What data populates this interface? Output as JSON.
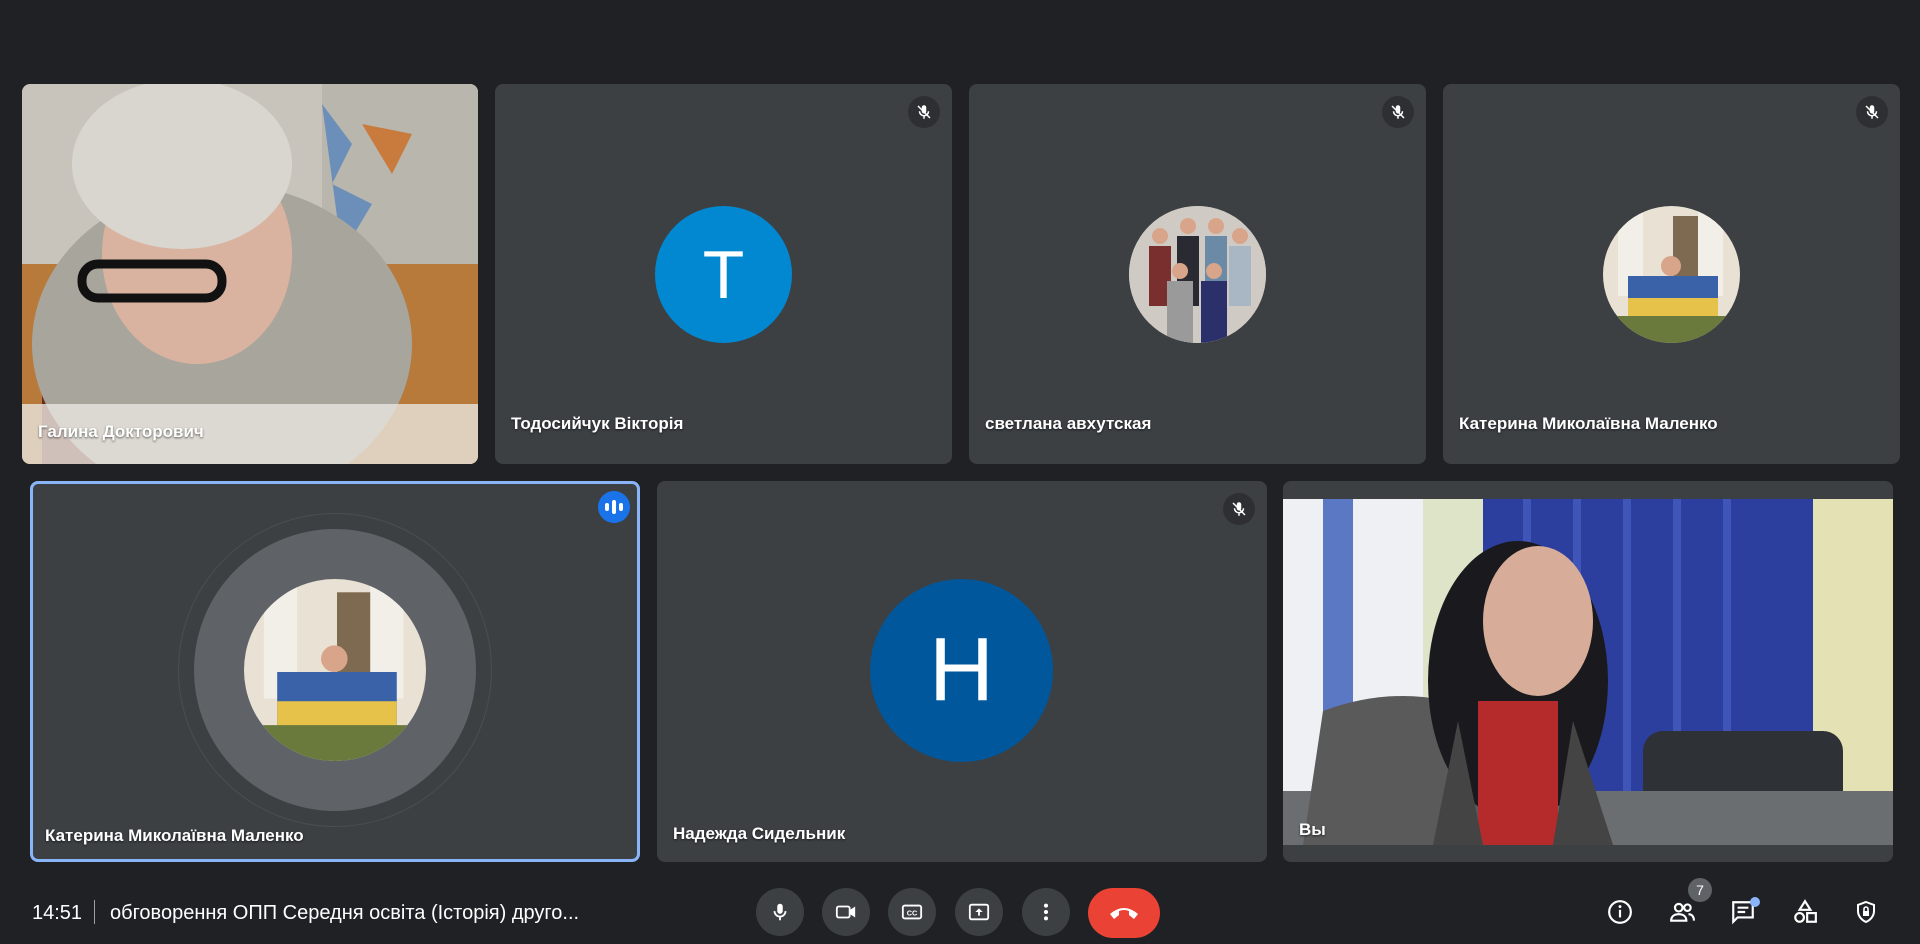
{
  "participants": [
    {
      "name": "Галина Докторович",
      "muted": false,
      "type": "video"
    },
    {
      "name": "Тодосийчук Вікторія",
      "muted": true,
      "type": "initial",
      "initial": "T",
      "color": "#0288d1"
    },
    {
      "name": "светлана авхутская",
      "muted": true,
      "type": "photo"
    },
    {
      "name": "Катерина Миколаївна Маленко",
      "muted": true,
      "type": "photo"
    },
    {
      "name": "Катерина Миколаївна Маленко",
      "muted": false,
      "speaking": true,
      "type": "photo"
    },
    {
      "name": "Надежда Сидельник",
      "muted": true,
      "type": "initial",
      "initial": "H",
      "color": "#01579b"
    },
    {
      "name": "Вы",
      "muted": false,
      "type": "video"
    }
  ],
  "bottom_bar": {
    "time": "14:51",
    "meeting_title": "обговорення ОПП Середня освіта (Історія) друго...",
    "controls": [
      "microphone-icon",
      "camera-icon",
      "captions-icon",
      "present-icon",
      "more-options-icon",
      "hang-up-icon"
    ],
    "right_icons": [
      "info-icon",
      "people-icon",
      "chat-icon",
      "activities-icon",
      "host-controls-icon"
    ],
    "participant_count": "7"
  },
  "colors": {
    "background": "#202124",
    "tile": "#3c4043",
    "hangup": "#ea4335",
    "accent": "#1a73e8"
  }
}
